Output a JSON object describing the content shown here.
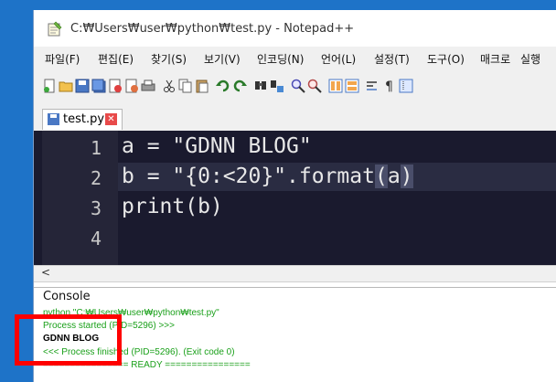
{
  "window": {
    "title": "C:₩Users₩user₩python₩test.py - Notepad++"
  },
  "menu": [
    "파일(F)",
    "편집(E)",
    "찾기(S)",
    "보기(V)",
    "인코딩(N)",
    "언어(L)",
    "설정(T)",
    "도구(O)",
    "매크로",
    "실행"
  ],
  "toolbar_icons": [
    "new-file-icon",
    "open-file-icon",
    "save-icon",
    "save-all-icon",
    "close-icon",
    "close-all-icon",
    "print-icon",
    "cut-icon",
    "copy-icon",
    "paste-icon",
    "undo-icon",
    "redo-icon",
    "find-icon",
    "replace-icon",
    "zoom-in-icon",
    "zoom-out-icon",
    "sync-v-icon",
    "sync-h-icon",
    "wrap-icon",
    "show-all-icon",
    "indent-guide-icon"
  ],
  "tab": {
    "label": "test.py",
    "close": "✕"
  },
  "editor": {
    "lines": [
      {
        "num": "1",
        "code": "a = \"GDNN BLOG\""
      },
      {
        "num": "2",
        "code_pre": "b = \"{0:<20}\".format",
        "code_hl_open": "(",
        "code_mid": "a",
        "code_hl_close": ")"
      },
      {
        "num": "3",
        "code": "print(b)"
      },
      {
        "num": "4",
        "code": ""
      }
    ]
  },
  "scroll": {
    "left_arrow": "<"
  },
  "console": {
    "title": "Console",
    "lines": [
      "python \"C:₩Users₩user₩python₩test.py\"",
      "Process started (PID=5296) >>>",
      "GDNN BLOG",
      "<<< Process finished (PID=5296). (Exit code 0)",
      "================ READY ================"
    ]
  },
  "colors": {
    "editor_bg": "#1a1a2e",
    "console_text": "#1aa01a",
    "highlight_box": "#ff0000",
    "desktop_blue": "#1e73c8"
  }
}
